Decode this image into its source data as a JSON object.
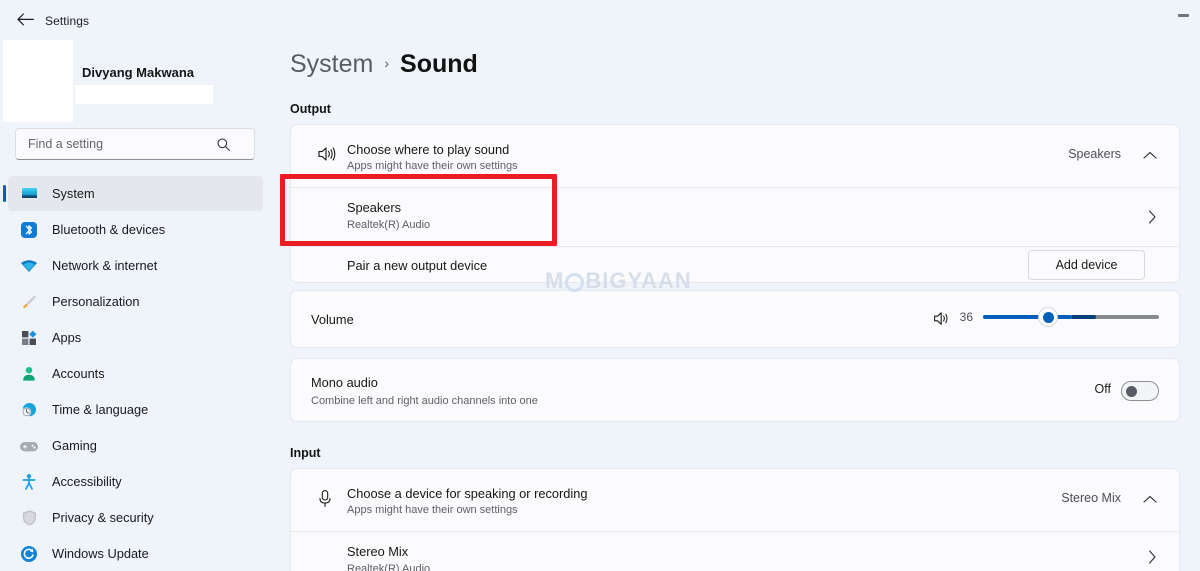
{
  "window": {
    "title": "Settings",
    "back_icon": "back-arrow-icon",
    "minimize_label": "Minimize"
  },
  "sidebar": {
    "account": {
      "name": "Divyang Makwana",
      "email_redacted": ""
    },
    "search": {
      "placeholder": "Find a setting",
      "value": "",
      "icon": "search-icon"
    },
    "items": [
      {
        "label": "System",
        "icon": "monitor-icon",
        "selected": true
      },
      {
        "label": "Bluetooth & devices",
        "icon": "bluetooth-icon",
        "selected": false
      },
      {
        "label": "Network & internet",
        "icon": "wifi-icon",
        "selected": false
      },
      {
        "label": "Personalization",
        "icon": "paintbrush-icon",
        "selected": false
      },
      {
        "label": "Apps",
        "icon": "apps-grid-icon",
        "selected": false
      },
      {
        "label": "Accounts",
        "icon": "person-icon",
        "selected": false
      },
      {
        "label": "Time & language",
        "icon": "clock-globe-icon",
        "selected": false
      },
      {
        "label": "Gaming",
        "icon": "gamepad-icon",
        "selected": false
      },
      {
        "label": "Accessibility",
        "icon": "accessibility-person-icon",
        "selected": false
      },
      {
        "label": "Privacy & security",
        "icon": "shield-icon",
        "selected": false
      },
      {
        "label": "Windows Update",
        "icon": "refresh-circle-icon",
        "selected": false
      }
    ]
  },
  "breadcrumb": {
    "parent": "System",
    "separator": "›",
    "current": "Sound"
  },
  "output": {
    "section_label": "Output",
    "choose_device": {
      "icon": "speaker-icon",
      "title": "Choose where to play sound",
      "subtitle": "Apps might have their own settings",
      "value": "Speakers",
      "chevron": "chevron-up-icon"
    },
    "device": {
      "title": "Speakers",
      "subtitle": "Realtek(R) Audio",
      "chevron": "chevron-right-icon",
      "highlighted": true
    },
    "pair": {
      "title": "Pair a new output device",
      "button_label": "Add device"
    },
    "volume": {
      "title": "Volume",
      "icon": "speaker-icon",
      "value": "36",
      "level": 36
    },
    "mono": {
      "title": "Mono audio",
      "subtitle": "Combine left and right audio channels into one",
      "state_label": "Off",
      "state_on": false
    }
  },
  "input": {
    "section_label": "Input",
    "choose_device": {
      "icon": "microphone-icon",
      "title": "Choose a device for speaking or recording",
      "subtitle": "Apps might have their own settings",
      "value": "Stereo Mix",
      "chevron": "chevron-up-icon"
    },
    "device": {
      "title": "Stereo Mix",
      "subtitle": "Realtek(R) Audio",
      "chevron": "chevron-right-icon"
    }
  },
  "watermark": {
    "part1": "M",
    "part2": "BIGYAAN"
  },
  "colors": {
    "accent": "#005fb8",
    "annotation": "#ea1c24",
    "page_bg": "#eff3fa",
    "card_bg": "#fbfbfd"
  }
}
